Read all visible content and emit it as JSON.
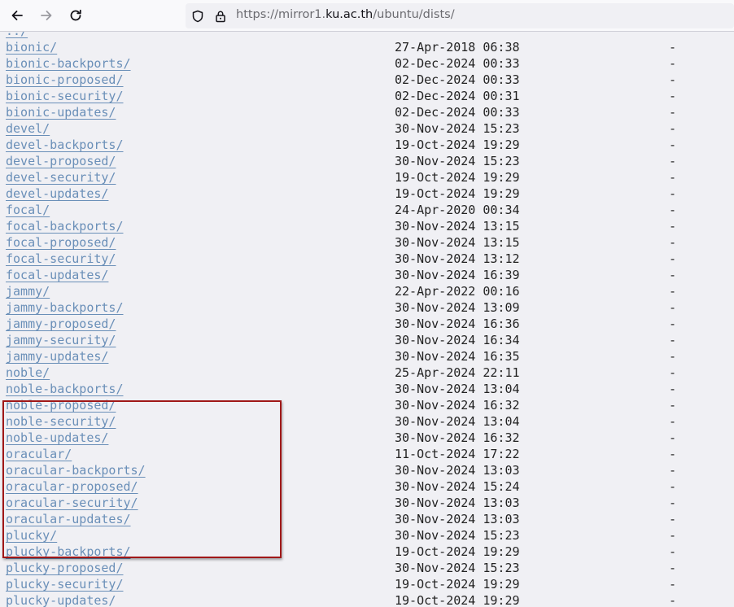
{
  "browser": {
    "url_prefix": "https://mirror1.",
    "url_host": "ku.ac.th",
    "url_path": "/ubuntu/dists/"
  },
  "listing": {
    "parent_link": "../",
    "entries": [
      {
        "name": "bionic/",
        "date": "27-Apr-2018 06:38",
        "size": "-"
      },
      {
        "name": "bionic-backports/",
        "date": "02-Dec-2024 00:33",
        "size": "-"
      },
      {
        "name": "bionic-proposed/",
        "date": "02-Dec-2024 00:33",
        "size": "-"
      },
      {
        "name": "bionic-security/",
        "date": "02-Dec-2024 00:31",
        "size": "-"
      },
      {
        "name": "bionic-updates/",
        "date": "02-Dec-2024 00:33",
        "size": "-"
      },
      {
        "name": "devel/",
        "date": "30-Nov-2024 15:23",
        "size": "-"
      },
      {
        "name": "devel-backports/",
        "date": "19-Oct-2024 19:29",
        "size": "-"
      },
      {
        "name": "devel-proposed/",
        "date": "30-Nov-2024 15:23",
        "size": "-"
      },
      {
        "name": "devel-security/",
        "date": "19-Oct-2024 19:29",
        "size": "-"
      },
      {
        "name": "devel-updates/",
        "date": "19-Oct-2024 19:29",
        "size": "-"
      },
      {
        "name": "focal/",
        "date": "24-Apr-2020 00:34",
        "size": "-"
      },
      {
        "name": "focal-backports/",
        "date": "30-Nov-2024 13:15",
        "size": "-"
      },
      {
        "name": "focal-proposed/",
        "date": "30-Nov-2024 13:15",
        "size": "-"
      },
      {
        "name": "focal-security/",
        "date": "30-Nov-2024 13:12",
        "size": "-"
      },
      {
        "name": "focal-updates/",
        "date": "30-Nov-2024 16:39",
        "size": "-"
      },
      {
        "name": "jammy/",
        "date": "22-Apr-2022 00:16",
        "size": "-"
      },
      {
        "name": "jammy-backports/",
        "date": "30-Nov-2024 13:09",
        "size": "-"
      },
      {
        "name": "jammy-proposed/",
        "date": "30-Nov-2024 16:36",
        "size": "-"
      },
      {
        "name": "jammy-security/",
        "date": "30-Nov-2024 16:34",
        "size": "-"
      },
      {
        "name": "jammy-updates/",
        "date": "30-Nov-2024 16:35",
        "size": "-"
      },
      {
        "name": "noble/",
        "date": "25-Apr-2024 22:11",
        "size": "-"
      },
      {
        "name": "noble-backports/",
        "date": "30-Nov-2024 13:04",
        "size": "-"
      },
      {
        "name": "noble-proposed/",
        "date": "30-Nov-2024 16:32",
        "size": "-"
      },
      {
        "name": "noble-security/",
        "date": "30-Nov-2024 13:04",
        "size": "-"
      },
      {
        "name": "noble-updates/",
        "date": "30-Nov-2024 16:32",
        "size": "-"
      },
      {
        "name": "oracular/",
        "date": "11-Oct-2024 17:22",
        "size": "-"
      },
      {
        "name": "oracular-backports/",
        "date": "30-Nov-2024 13:03",
        "size": "-"
      },
      {
        "name": "oracular-proposed/",
        "date": "30-Nov-2024 15:24",
        "size": "-"
      },
      {
        "name": "oracular-security/",
        "date": "30-Nov-2024 13:03",
        "size": "-"
      },
      {
        "name": "oracular-updates/",
        "date": "30-Nov-2024 13:03",
        "size": "-"
      },
      {
        "name": "plucky/",
        "date": "30-Nov-2024 15:23",
        "size": "-"
      },
      {
        "name": "plucky-backports/",
        "date": "19-Oct-2024 19:29",
        "size": "-"
      },
      {
        "name": "plucky-proposed/",
        "date": "30-Nov-2024 15:23",
        "size": "-"
      },
      {
        "name": "plucky-security/",
        "date": "19-Oct-2024 19:29",
        "size": "-"
      },
      {
        "name": "plucky-updates/",
        "date": "19-Oct-2024 19:29",
        "size": "-"
      }
    ]
  },
  "colors": {
    "link": "#6a8fb8",
    "highlight_border": "#a01818"
  },
  "icons": {
    "back": "arrow-left-icon",
    "forward": "arrow-right-icon",
    "reload": "reload-icon",
    "tracking": "shield-icon",
    "lock": "lock-icon"
  }
}
